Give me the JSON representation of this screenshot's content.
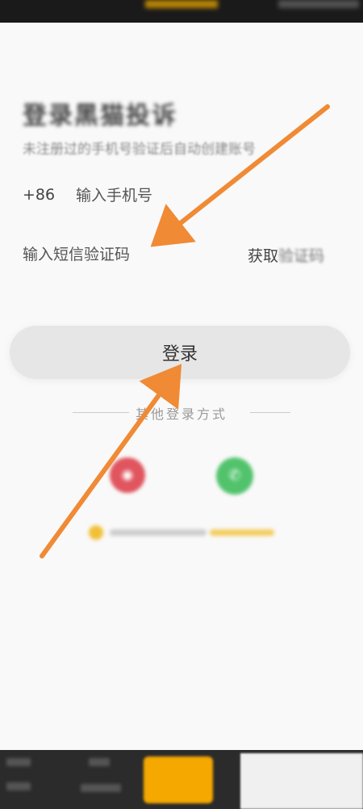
{
  "login": {
    "title": "登录黑猫投诉",
    "subtitle": "未注册过的手机号验证后自动创建账号",
    "country_code": "+86",
    "phone_placeholder": "输入手机号",
    "code_placeholder": "输入短信验证码",
    "get_code_prefix": "获取",
    "get_code_suffix": "验证码",
    "login_button": "登录",
    "other_methods": "其他登录方式"
  },
  "social": {
    "weibo_icon": "weibo-icon",
    "wechat_icon": "wechat-icon"
  },
  "colors": {
    "accent": "#f4a800",
    "arrow": "#f08a35",
    "weibo": "#e0555e",
    "wechat": "#52c36c",
    "button_bg": "#e6e6e6"
  }
}
